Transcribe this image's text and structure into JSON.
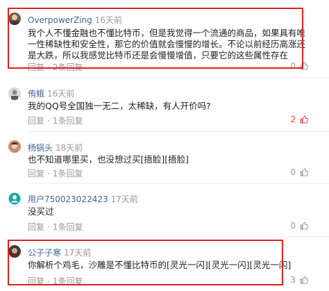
{
  "colors": {
    "username": "#406599",
    "meta": "#999999",
    "like_active": "#f04142",
    "highlight_box": "#e02020"
  },
  "reply_label": "回复",
  "comments": [
    {
      "user": "OverpowerZing",
      "time": "16天前",
      "text": "我个人不懂金融也不懂比特币，但是我觉得一个流通的商品，如果具有唯一性稀缺性和安全性，那它的价值就会慢慢的增长。不论以前经历高涨还是大跌，所以我感觉比特币还是会慢慢增值，只要它的这些属性存在",
      "replies": "2条回复",
      "likes": "0",
      "like_icon": "thumbs-up-icon",
      "highlighted": true
    },
    {
      "user": "侑蛾",
      "time": "16天前",
      "text": "我的QQ号全国独一无二，太稀缺，有人开价吗?",
      "replies": "1条回复",
      "likes": "2",
      "like_icon": "thumbs-up-icon",
      "highlighted": false
    },
    {
      "user": "杨锅头",
      "time": "18天前",
      "text": "也不知道哪里买，也没想过买[捂脸][捂脸]",
      "replies": "1条回复",
      "likes": "0",
      "like_icon": "thumbs-up-icon",
      "highlighted": false
    },
    {
      "user": "用户750023022423",
      "time": "17天前",
      "text": "没买过",
      "replies": "1条回复",
      "likes": "0",
      "like_icon": "thumbs-up-icon",
      "highlighted": false
    },
    {
      "user": "公子子寒",
      "time": "17天前",
      "text": "你解析个鸡毛，沙雕是不懂比特币的[灵光一闪][灵光一闪][灵光一闪]",
      "replies": "1条回复",
      "likes": "3",
      "like_icon": "thumbs-up-icon",
      "highlighted": true
    }
  ]
}
